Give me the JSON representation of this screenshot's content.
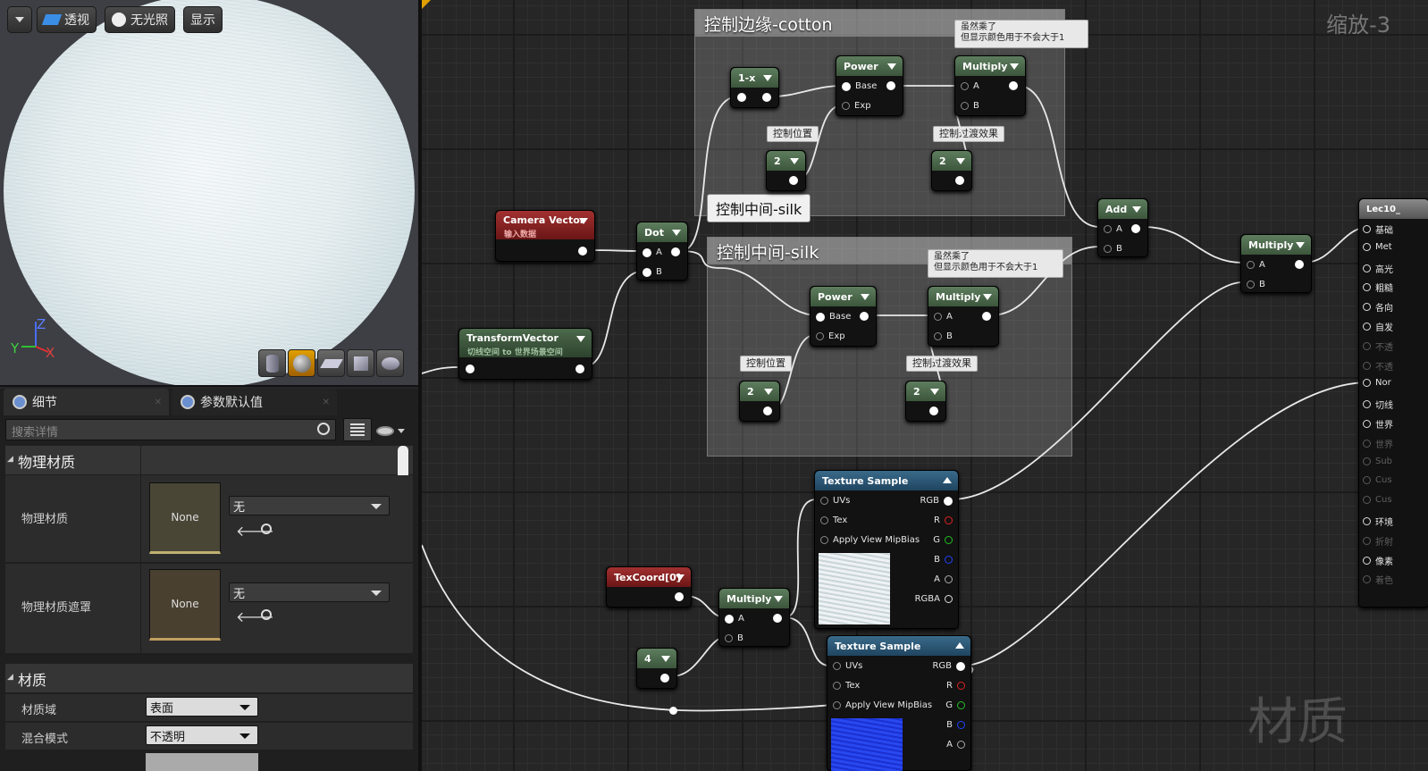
{
  "viewport": {
    "perspective": "透视",
    "unlit": "无光照",
    "show": "显示",
    "axis_z": "Z",
    "axis_y": "Y",
    "axis_x": "X"
  },
  "details": {
    "tab_details": "细节",
    "tab_params": "参数默认值",
    "search_placeholder": "搜索详情",
    "section_physical": "物理材质",
    "phys_mat_label": "物理材质",
    "phys_mat_thumb": "None",
    "phys_mat_value": "无",
    "phys_mask_label": "物理材质遮罩",
    "phys_mask_thumb": "None",
    "phys_mask_value": "无",
    "section_material": "材质",
    "domain_label": "材质域",
    "domain_value": "表面",
    "blend_label": "混合模式",
    "blend_value": "不透明"
  },
  "graph": {
    "zoom": "缩放-3",
    "watermark": "材质",
    "comment1": "控制边缘-cotton",
    "comment2": "控制中间-silk",
    "comment2_tooltip": "控制中间-silk",
    "note_mult": "虽然乘了\n但显示颜色用于不会大于1",
    "note_pos": "控制位置",
    "note_trans": "控制过渡效果",
    "node_power": "Power",
    "node_multiply": "Multiply",
    "node_oneminus": "1-x",
    "pin_base": "Base",
    "pin_exp": "Exp",
    "pin_a": "A",
    "pin_b": "B",
    "const_2": "2",
    "const_4": "4",
    "node_camera": "Camera Vector",
    "camera_sub": "输入数据",
    "node_dot": "Dot",
    "node_transform": "TransformVector",
    "transform_sub": "切线空间 to 世界场景空间",
    "node_add": "Add",
    "node_texcoord": "TexCoord[0]",
    "node_texsample": "Texture Sample",
    "pin_uvs": "UVs",
    "pin_tex": "Tex",
    "pin_mip": "Apply View MipBias",
    "pin_rgb": "RGB",
    "pin_r": "R",
    "pin_g": "G",
    "pin_bb": "B",
    "pin_aa": "A",
    "pin_rgba": "RGBA",
    "result_title": "Lec10_",
    "result_pins": [
      "基础",
      "Met",
      "高光",
      "粗糙",
      "各向",
      "自发",
      "不透",
      "不透",
      "Nor",
      "切线",
      "世界",
      "世界",
      "Sub",
      "Cus",
      "Cus",
      "环境",
      "折射",
      "像素",
      "着色"
    ]
  },
  "colors": {
    "accent_orange": "#e0a000",
    "pin_red": "#e02020",
    "pin_green": "#20c020",
    "pin_blue": "#2040ff"
  }
}
